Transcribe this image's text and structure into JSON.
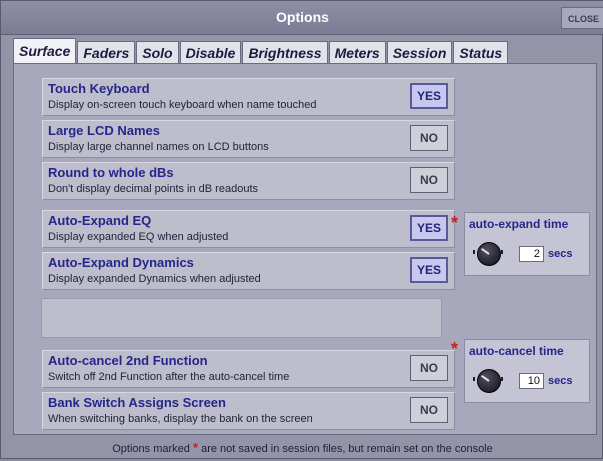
{
  "window": {
    "title": "Options",
    "close_label": "CLOSE"
  },
  "tabs": [
    {
      "label": "Surface",
      "active": true
    },
    {
      "label": "Faders"
    },
    {
      "label": "Solo"
    },
    {
      "label": "Disable"
    },
    {
      "label": "Brightness"
    },
    {
      "label": "Meters"
    },
    {
      "label": "Session"
    },
    {
      "label": "Status"
    }
  ],
  "options": [
    {
      "title": "Touch Keyboard",
      "desc": "Display on-screen touch keyboard when name touched",
      "value": "YES"
    },
    {
      "title": "Large LCD Names",
      "desc": "Display large channel names on LCD buttons",
      "value": "NO"
    },
    {
      "title": "Round to whole dBs",
      "desc": "Don't display decimal points in dB readouts",
      "value": "NO"
    },
    {
      "title": "Auto-Expand EQ",
      "desc": "Display expanded EQ when adjusted",
      "value": "YES"
    },
    {
      "title": "Auto-Expand Dynamics",
      "desc": "Display expanded Dynamics when adjusted",
      "value": "YES"
    },
    {
      "title": "Auto-cancel 2nd Function",
      "desc": "Switch off 2nd Function after the auto-cancel time",
      "value": "NO"
    },
    {
      "title": "Bank Switch Assigns Screen",
      "desc": "When switching banks, display the bank on the screen",
      "value": "NO"
    }
  ],
  "auto_expand": {
    "marker": "*",
    "label": "auto-expand time",
    "value": "2",
    "unit": "secs"
  },
  "auto_cancel": {
    "marker": "*",
    "label": "auto-cancel time",
    "value": "10",
    "unit": "secs"
  },
  "footer": {
    "before": "Options marked",
    "star": "*",
    "after": "are not saved in session files, but remain set on the console"
  },
  "icons": {
    "knob": "rotary-knob-icon"
  },
  "colors": {
    "accent_text": "#26268a",
    "marker": "#cc2020",
    "yes_button": "#c8c8ee"
  }
}
